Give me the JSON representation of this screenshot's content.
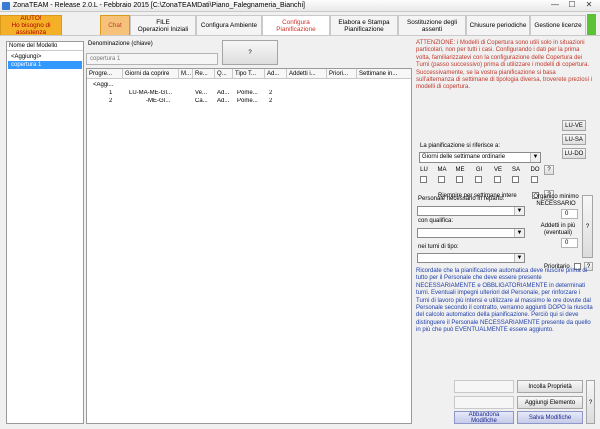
{
  "window": {
    "title": "ZonaTEAM - Release 2.0.L - Febbraio 2015 [C:\\ZonaTEAMDati\\Piano_Falegnameria_Bianchi]",
    "minimize": "—",
    "maximize": "☐",
    "close": "✕"
  },
  "tabs": {
    "help": {
      "line1": "AIUTO!",
      "line2": "Ho bisogno di assistenza"
    },
    "chat": "Chat",
    "file": {
      "line1": "FILE",
      "line2": "Operazioni Iniziali"
    },
    "ambiente": "Configura Ambiente",
    "pianificazione": {
      "line1": "Configura",
      "line2": "Pianificazione"
    },
    "elabora": {
      "line1": "Elabora e Stampa",
      "line2": "Pianificazione"
    },
    "sostituzione": {
      "line1": "Sostituzione degli",
      "line2": "assenti"
    },
    "chiusure": "Chiusure periodiche",
    "licenze": "Gestione licenze"
  },
  "left_panel": {
    "header": "Nome del Modello",
    "items": [
      "<Aggiungi>",
      "copertura 1"
    ]
  },
  "denominazione": {
    "label": "Denominazione (chiave)",
    "value": "copertura 1",
    "help": "?"
  },
  "grid": {
    "headers": [
      "Progre...",
      "Giorni da coprire",
      "M...",
      "Re...",
      "Q...",
      "Tipo T...",
      "Ad...",
      "Addetti i...",
      "Priori...",
      "Settimane in..."
    ],
    "add_row": "<Aggi...",
    "rows": [
      [
        "1",
        "LU-MA-ME-GI...",
        "",
        "Ve...",
        "Ad...",
        "Pome...",
        "2",
        "",
        "",
        ""
      ],
      [
        "2",
        "-ME-GI...",
        "",
        "Ca...",
        "Ad...",
        "Pome...",
        "2",
        "",
        "",
        ""
      ]
    ]
  },
  "attention": "ATTENZIONE: i Modelli di Copertura sono utili solo in situazioni particolari, non per tutti i casi. Configurando i dati per la prima volta, familiarizzatevi con la configurazione delle Copertura dei Turni (passo successivo) prima di utilizzare i modelli di copertura. Successivamente, se la vostra pianificazione si basa sull'alternanza di settimane di tipologia diversa, troverete preziosi i modelli di copertura.",
  "settimane": {
    "label": "La pianificazione si riferisce a:",
    "selected": "Giorni delle settimane ordinarie",
    "days": [
      "LU",
      "MA",
      "ME",
      "GI",
      "VE",
      "SA",
      "DO"
    ],
    "btn_luve": "LU-VE",
    "btn_lusa": "LU-SA",
    "btn_ludo": "LU-DO",
    "riempire": "Riempire per settimane intere",
    "help": "?"
  },
  "personale": {
    "reparto_label": "Personale necessario in reparto:",
    "qualifica_label": "con qualifica:",
    "turni_label": "nei turni di tipo:",
    "organico_label": "Organico minimo NECESSARIO",
    "organico_value": "0",
    "addetti_label": "Addetti in più (eventuali)",
    "addetti_value": "0",
    "prioritario_label": "Prioritario",
    "help": "?"
  },
  "info": "Ricordate che la pianificazione automatica deve riuscire prima di tutto per il Personale che deve essere presente NECESSARIAMENTE e OBBLIGATORIAMENTE in determinati turni. Eventuali impegni ulteriori del Personale, per rinforzare i Turni di lavoro più intensi e utilizzare al massimo le ore dovute dal Personale secondo il contratto, verranno aggiunti DOPO la riuscita del calcolo automatico della pianificazione. Perciò qui si deve distinguere il Personale NECESSARIAMENTE presente da quello in più che può EVENTUALMENTE essere aggiunto.",
  "actions": {
    "incolla": "Incolla Proprietà",
    "aggiungi": "Aggiungi Elemento",
    "abbandona": "Abbandona Modifiche",
    "salva": "Salva Modifiche",
    "help": "?"
  }
}
